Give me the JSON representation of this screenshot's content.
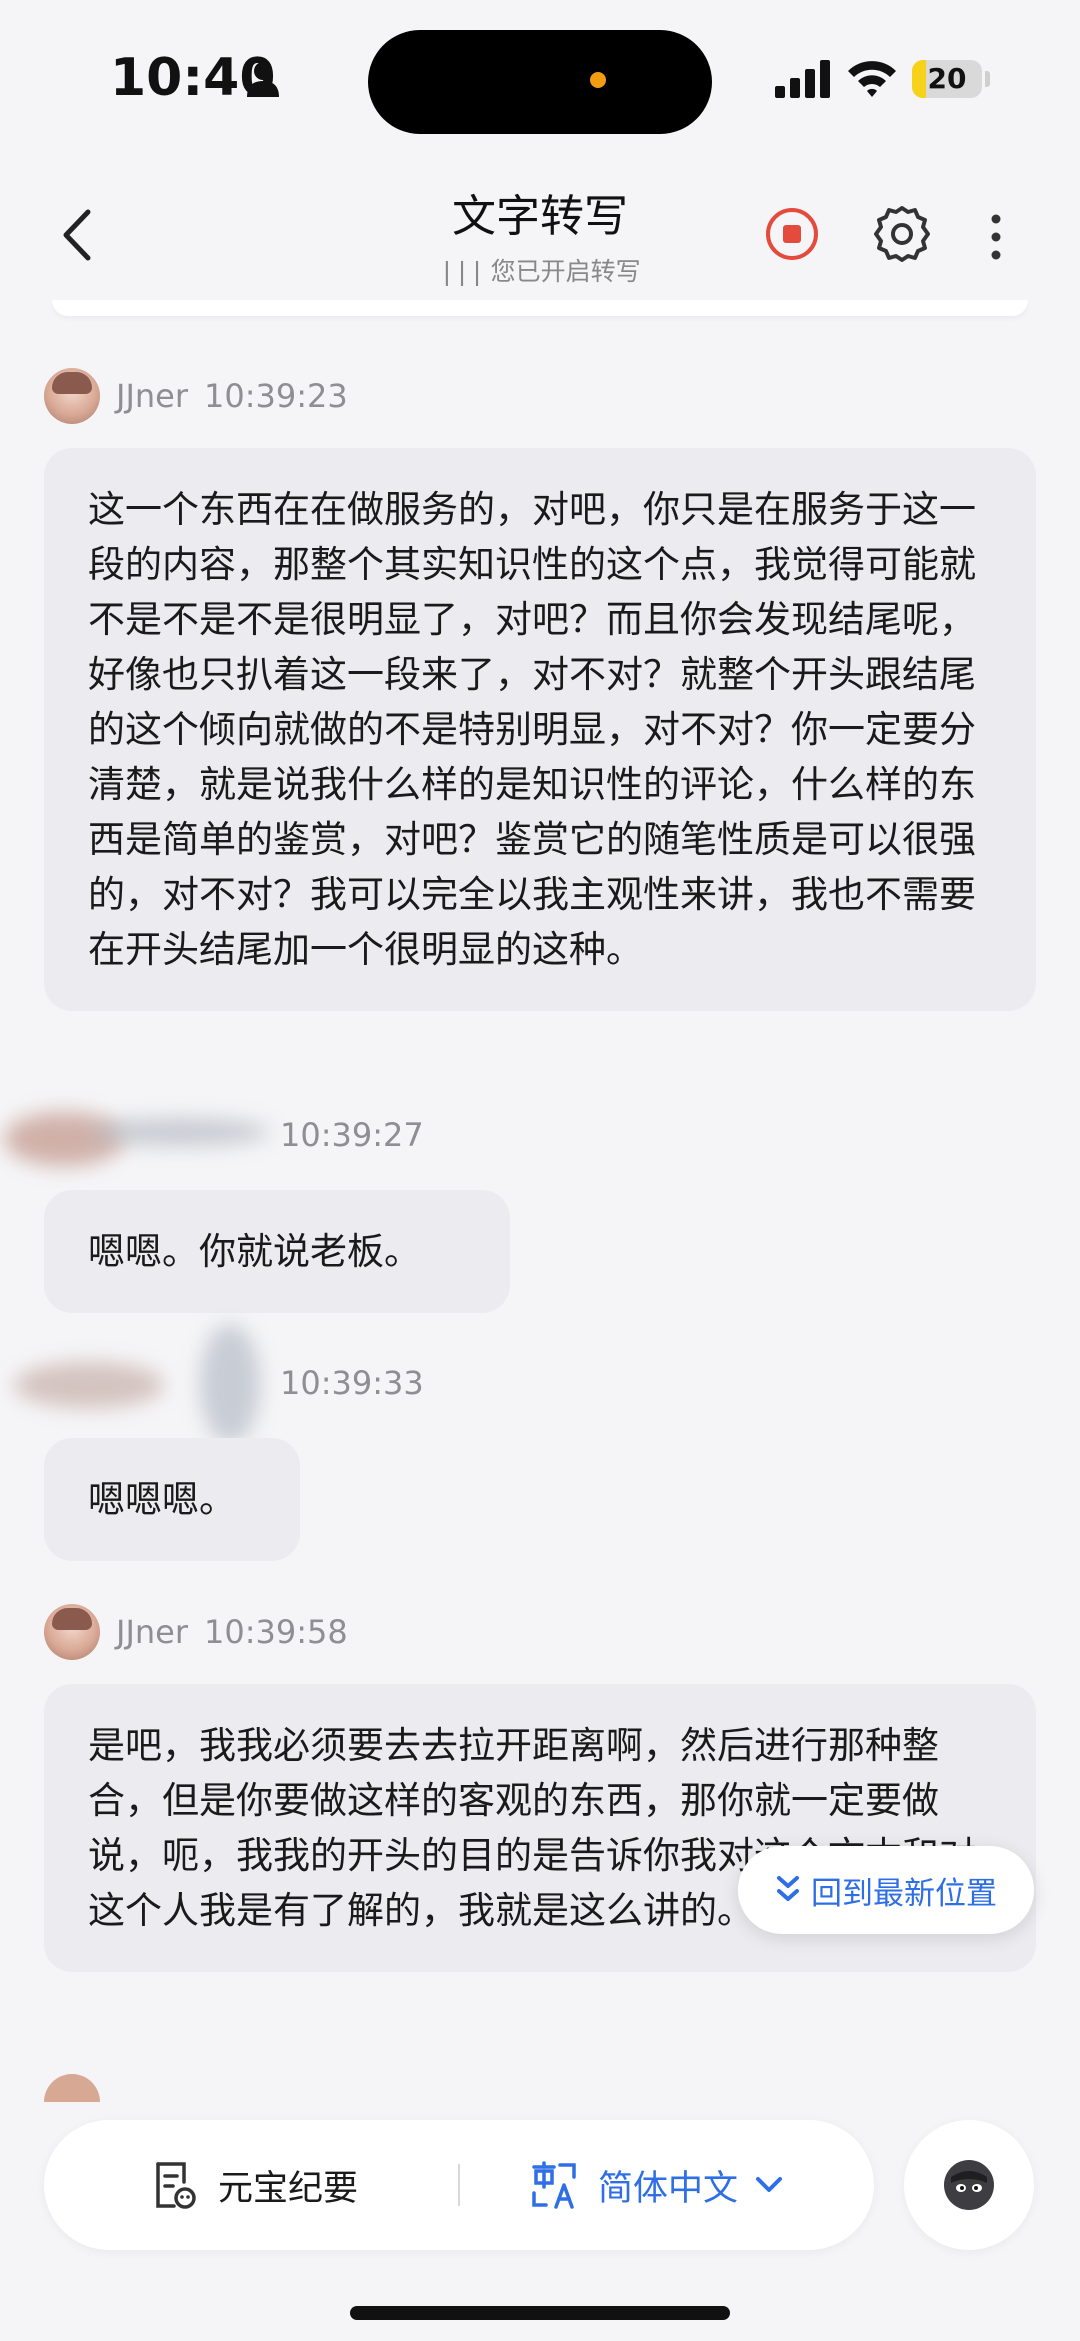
{
  "status_bar": {
    "time": "10:40",
    "battery_level": "20",
    "battery_fraction": 0.2,
    "icons": [
      "person-icon",
      "signal-icon",
      "wifi-icon",
      "battery-icon"
    ]
  },
  "header": {
    "title": "文字转写",
    "subtitle_wave": "|||",
    "subtitle": "您已开启转写",
    "icons": [
      "back-icon",
      "record-stop-icon",
      "gear-icon",
      "more-icon"
    ],
    "record_color": "#e44b3c"
  },
  "messages": [
    {
      "speaker": "JJner",
      "time": "10:39:23",
      "text": "这一个东西在在做服务的，对吧，你只是在服务于这一段的内容，那整个其实知识性的这个点，我觉得可能就不是不是不是很明显了，对吧？而且你会发现结尾呢，好像也只扒着这一段来了，对不对？就整个开头跟结尾的这个倾向就做的不是特别明显，对不对？你一定要分清楚，就是说我什么样的是知识性的评论，什么样的东西是简单的鉴赏，对吧？鉴赏它的随笔性质是可以很强的，对不对？我可以完全以我主观性来讲，我也不需要在开头结尾加一个很明显的这种。"
    },
    {
      "speaker": "",
      "time": "10:39:27",
      "text": "嗯嗯。你就说老板。"
    },
    {
      "speaker": "",
      "time": "10:39:33",
      "text": "嗯嗯嗯。"
    },
    {
      "speaker": "JJner",
      "time": "10:39:58",
      "text": "是吧，我我必须要去去拉开距离啊，然后进行那种整合，但是你要做这样的客观的东西，那你就一定要做说，呃，我我的开头的目的是告诉你我对这个文本和对这个人我是有了解的，我就是这么讲的。"
    }
  ],
  "jump_button": {
    "label": "回到最新位置"
  },
  "bottom_bar": {
    "summary_label": "元宝纪要",
    "language_label": "简体中文",
    "accent_color": "#2f6fe6"
  }
}
